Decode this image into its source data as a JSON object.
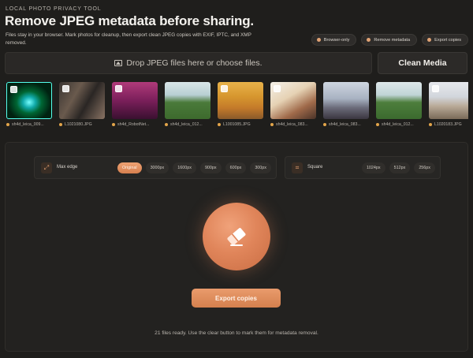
{
  "header": {
    "eyebrow": "LOCAL PHOTO PRIVACY TOOL",
    "title": "Remove JPEG metadata before sharing.",
    "description": "Files stay in your browser. Mark photos for cleanup, then export clean JPEG copies with EXIF, IPTC, and XMP removed."
  },
  "pills": [
    {
      "label": "Browser-only",
      "icon": "shield-icon"
    },
    {
      "label": "Remove metadata",
      "icon": "eraser-icon"
    },
    {
      "label": "Export copies",
      "icon": "download-icon"
    }
  ],
  "dropzone": {
    "label": "Drop JPEG files here or choose files.",
    "icon": "image-icon"
  },
  "clean_button": {
    "label": "Clean Media"
  },
  "thumbnails": [
    {
      "name": "sh4d_leica_009..."
    },
    {
      "name": "L1021080.JPG"
    },
    {
      "name": "sh4d_RobotNet..."
    },
    {
      "name": "sh4d_leica_012..."
    },
    {
      "name": "L1001085.JPG"
    },
    {
      "name": "sh4d_leica_083..."
    },
    {
      "name": "sh4d_leica_083..."
    },
    {
      "name": "sh4d_leica_012..."
    },
    {
      "name": "L1020183.JPG"
    }
  ],
  "max_edge": {
    "label": "Max edge",
    "icon": "resize-icon",
    "options": [
      "Original",
      "3000px",
      "1600px",
      "900px",
      "600px",
      "300px"
    ],
    "selected": "Original"
  },
  "square": {
    "label": "Square",
    "icon": "crop-icon",
    "options": [
      "1024px",
      "512px",
      "256px"
    ]
  },
  "center_icon": "eraser-icon",
  "export_button": {
    "label": "Export copies"
  },
  "status": "21 files ready. Use the clear button to mark them for metadata removal.",
  "colors": {
    "accent": "#e08a5a",
    "background": "#1f1e1c",
    "panel": "#232220"
  }
}
